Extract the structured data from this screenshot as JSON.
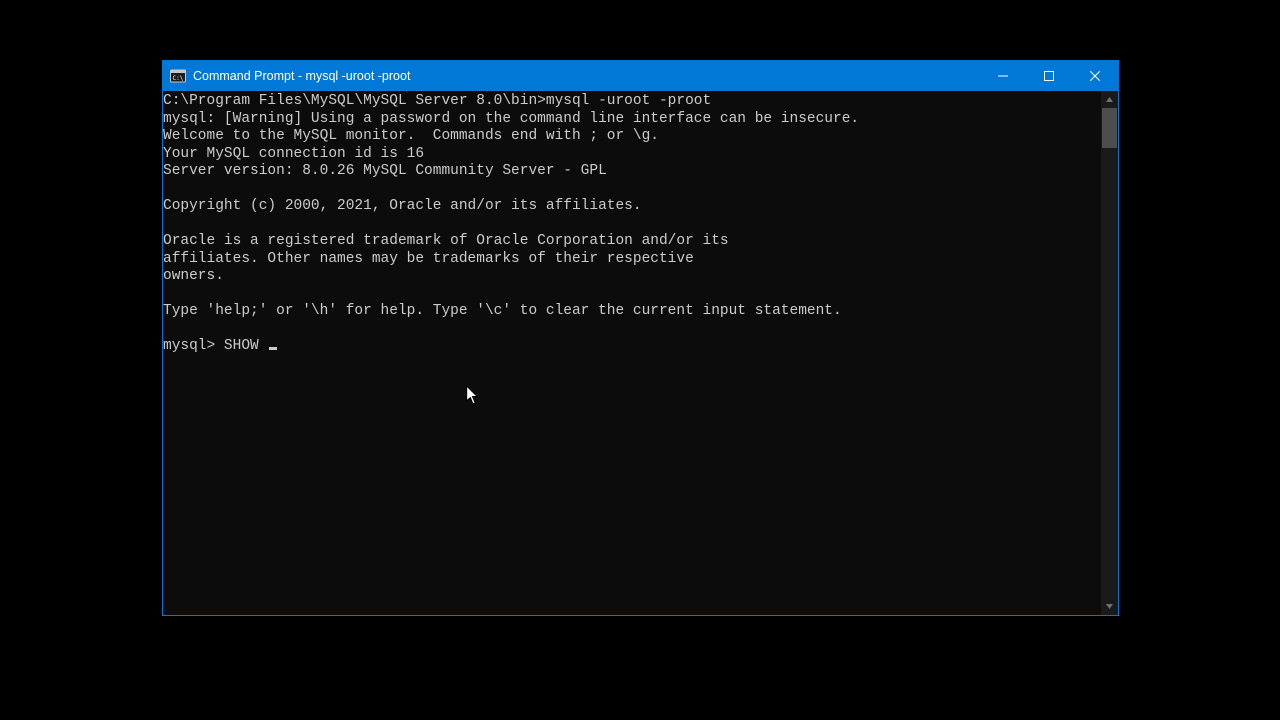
{
  "window": {
    "title": "Command Prompt - mysql  -uroot -proot"
  },
  "terminal": {
    "lines": [
      "C:\\Program Files\\MySQL\\MySQL Server 8.0\\bin>mysql -uroot -proot",
      "mysql: [Warning] Using a password on the command line interface can be insecure.",
      "Welcome to the MySQL monitor.  Commands end with ; or \\g.",
      "Your MySQL connection id is 16",
      "Server version: 8.0.26 MySQL Community Server - GPL",
      "",
      "Copyright (c) 2000, 2021, Oracle and/or its affiliates.",
      "",
      "Oracle is a registered trademark of Oracle Corporation and/or its",
      "affiliates. Other names may be trademarks of their respective",
      "owners.",
      "",
      "Type 'help;' or '\\h' for help. Type '\\c' to clear the current input statement.",
      ""
    ],
    "prompt": "mysql> ",
    "current_input": "SHOW "
  }
}
